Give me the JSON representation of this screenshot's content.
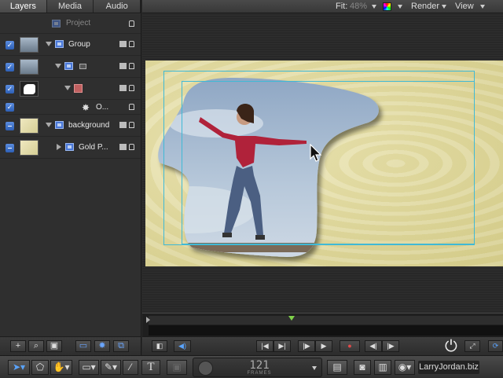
{
  "tabs": [
    {
      "label": "Layers"
    },
    {
      "label": "Media"
    },
    {
      "label": "Audio"
    }
  ],
  "layers": {
    "project_label": "Project",
    "group_label": "Group",
    "o_label": "O...",
    "background_label": "background",
    "gold_label": "Gold P..."
  },
  "topbar": {
    "fit_label": "Fit:",
    "fit_value": "48%",
    "render_label": "Render",
    "view_label": "View"
  },
  "footer_icons": [
    "add-icon",
    "search-icon",
    "layout-icon",
    "view-icon",
    "gear-icon",
    "stack-icon"
  ],
  "transport": {
    "icons": [
      "layer-list-icon",
      "audio-icon",
      "go-to-start-icon",
      "step-forward-icon",
      "step-back-icon",
      "play-icon",
      "record-icon",
      "prev-icon",
      "next-icon",
      "power-icon",
      "fullscreen-icon",
      "loop-icon"
    ]
  },
  "bottombar": {
    "text_tool": "T",
    "frames_value": "121",
    "frames_unit": "FRAMES",
    "brand": "LarryJordan.biz"
  },
  "colors": {
    "accent_blue": "#3d7ce0",
    "guide": "#3fb9d6",
    "playhead": "#7fd24a",
    "canvas_sand": "#e3dca4"
  }
}
